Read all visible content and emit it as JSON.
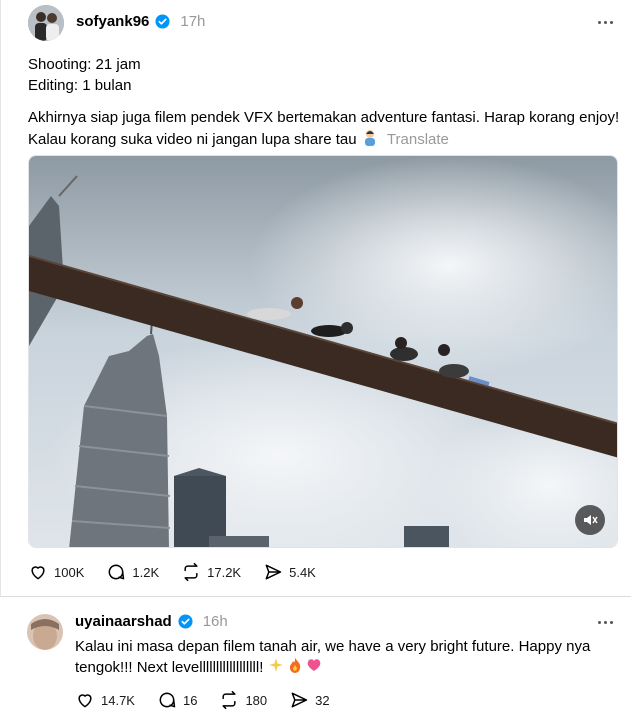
{
  "post": {
    "username": "sofyank96",
    "time": "17h",
    "line1": "Shooting: 21 jam",
    "line2": "Editing: 1 bulan",
    "body_line1": "Akhirnya siap juga filem pendek VFX bertemakan adventure fantasi. Harap korang enjoy!",
    "body_line2": "Kalau korang suka video ni jangan lupa share tau",
    "translate": "Translate",
    "stats": {
      "likes": "100K",
      "replies": "1.2K",
      "reposts": "17.2K",
      "shares": "5.4K"
    }
  },
  "reply": {
    "username": "uyainaarshad",
    "time": "16h",
    "line1": "Kalau ini masa depan filem tanah air, we have a very bright future. Happy nya",
    "line2": "tengok!!! Next levellllllllllllllllll!",
    "stats": {
      "likes": "14.7K",
      "replies": "16",
      "reposts": "180",
      "shares": "32"
    }
  },
  "colors": {
    "verified": "#0095f6",
    "muted_text": "#999999",
    "sky": "#c9d3dc",
    "beam": "#3a2a22"
  },
  "icons": [
    "heart-icon",
    "comment-icon",
    "repost-icon",
    "share-icon",
    "verified-icon",
    "more-icon",
    "mute-icon"
  ]
}
